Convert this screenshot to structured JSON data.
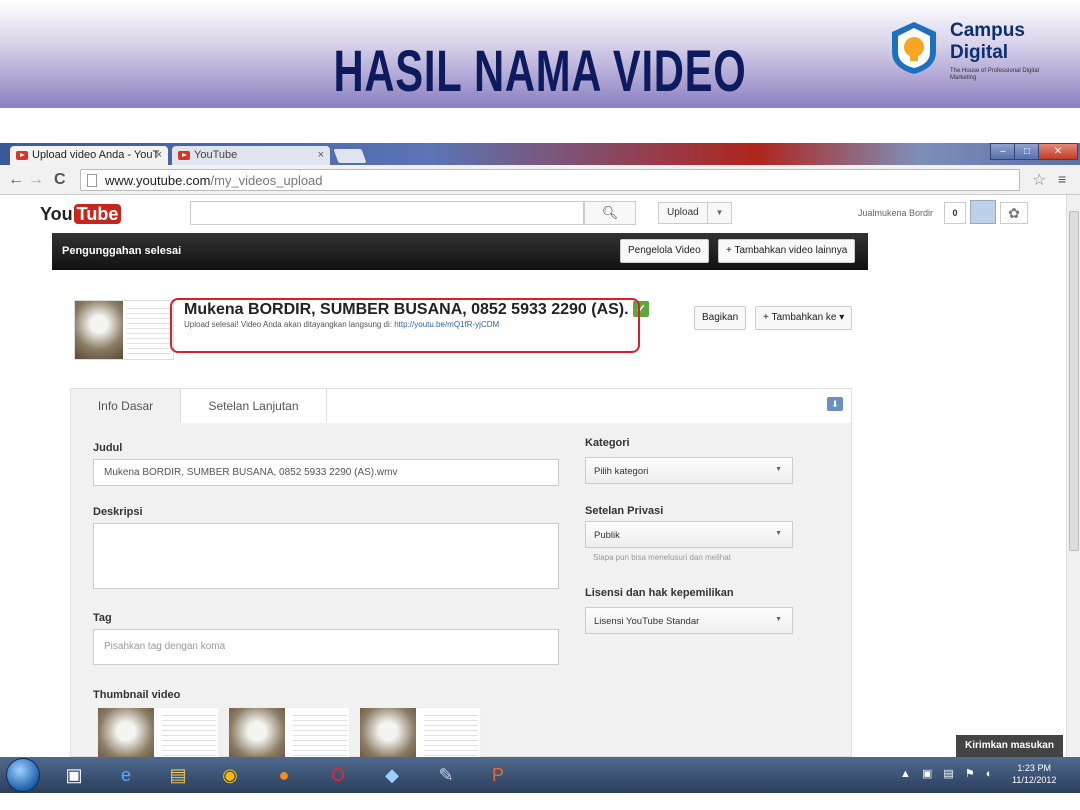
{
  "slide": {
    "title": "HASIL NAMA VIDEO",
    "logo_line1": "Campus",
    "logo_line2": "Digital",
    "logo_tagline": "The House of Professional Digital Marketing"
  },
  "browser": {
    "tabs": [
      {
        "label": "Upload video Anda - YouT",
        "close": "×"
      },
      {
        "label": "YouTube",
        "close": "×"
      }
    ],
    "url_domain": "www.youtube.com",
    "url_path": "/my_videos_upload"
  },
  "youtube": {
    "logo_you": "You",
    "logo_tube": "Tube",
    "search_value": "",
    "upload_label": "Upload",
    "user_name": "Jualmukena Bordir",
    "notif_count": "0"
  },
  "done_bar": {
    "title": "Pengunggahan selesai",
    "manager_button": "Pengelola Video",
    "add_more_button": "+ Tambahkan video lainnya"
  },
  "video": {
    "title": "Mukena BORDIR, SUMBER BUSANA, 0852 5933 2290 (AS).",
    "status_text": "Upload selesai! Video Anda akan ditayangkan langsung di: ",
    "link": "http://youtu.be/mQ1fR-yjCDM",
    "share_button": "Bagikan",
    "add_to_button": "+ Tambahkan ke"
  },
  "form": {
    "tabs": [
      "Info Dasar",
      "Setelan Lanjutan"
    ],
    "title_label": "Judul",
    "title_value": "Mukena BORDIR, SUMBER BUSANA, 0852 5933 2290 (AS).wmv",
    "description_label": "Deskripsi",
    "description_value": "",
    "tag_label": "Tag",
    "tag_placeholder": "Pisahkan tag dengan koma",
    "thumbnail_label": "Thumbnail video",
    "category_label": "Kategori",
    "category_value": "Pilih kategori",
    "privacy_label": "Setelan Privasi",
    "privacy_value": "Publik",
    "privacy_hint": "Siapa pun bisa menelusuri dan melihat",
    "license_label": "Lisensi dan hak kepemilikan",
    "license_value": "Lisensi YouTube Standar"
  },
  "feedback_button": "Kirimkan masukan",
  "taskbar": {
    "time": "1:23 PM",
    "date": "11/12/2012"
  },
  "colors": {
    "highlight": "#d6202a",
    "yt_red": "#c8261a",
    "check_green": "#5aa83a",
    "slide_title": "#0d1b5e"
  }
}
